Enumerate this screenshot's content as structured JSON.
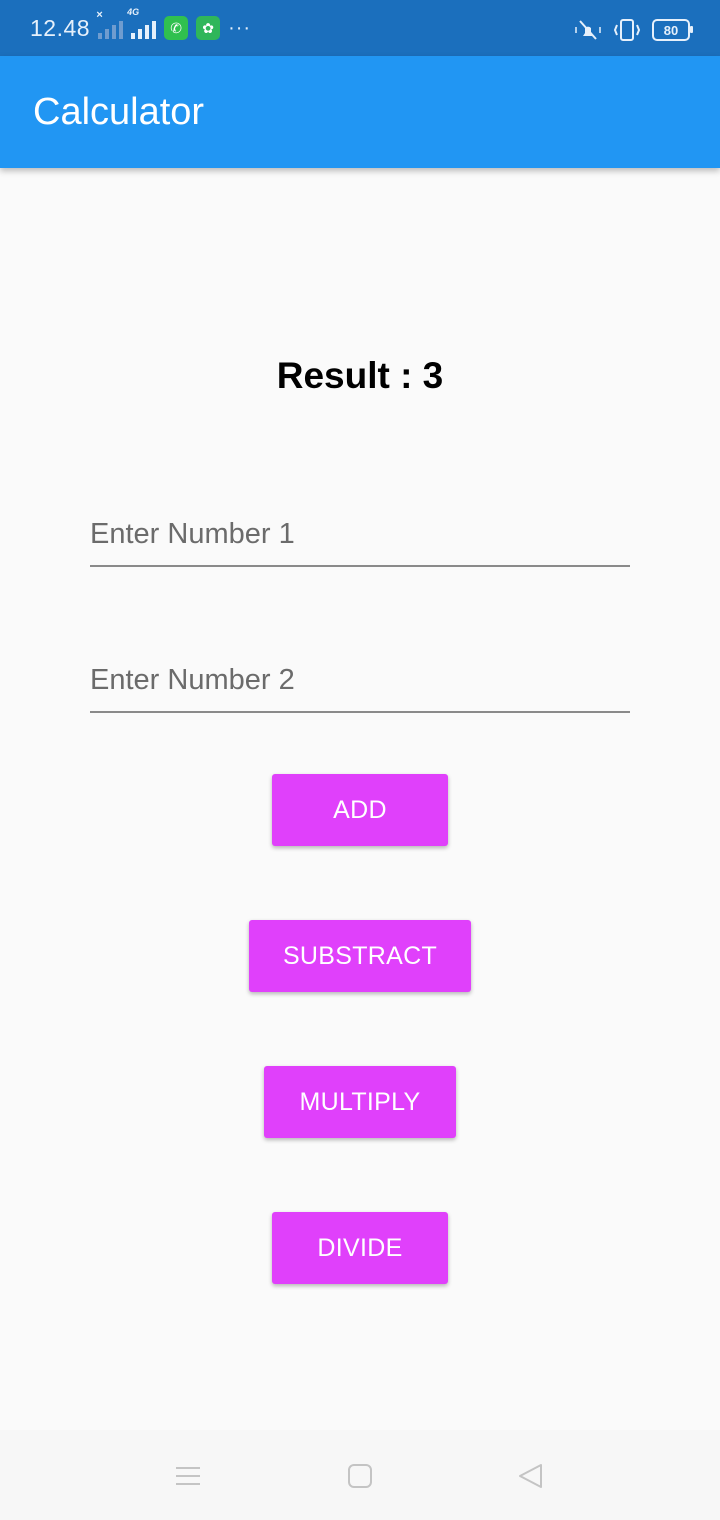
{
  "status_bar": {
    "time": "12.48",
    "battery": "80",
    "overflow": "···"
  },
  "app_bar": {
    "title": "Calculator"
  },
  "result": {
    "text": "Result : 3"
  },
  "inputs": {
    "number1": {
      "placeholder": "Enter Number 1",
      "value": ""
    },
    "number2": {
      "placeholder": "Enter Number 2",
      "value": ""
    }
  },
  "buttons": {
    "add": "ADD",
    "subtract": "SUBSTRACT",
    "multiply": "MULTIPLY",
    "divide": "DIVIDE"
  },
  "colors": {
    "status_bar": "#1b6fbd",
    "app_bar": "#2196f3",
    "button": "#e040fb",
    "background": "#fafafa"
  },
  "icons": [
    "signal-x-icon",
    "signal-4g-icon",
    "whatsapp-icon",
    "app-notification-icon",
    "mute-icon",
    "vibrate-icon",
    "battery-icon",
    "menu-icon",
    "home-icon",
    "back-icon"
  ]
}
